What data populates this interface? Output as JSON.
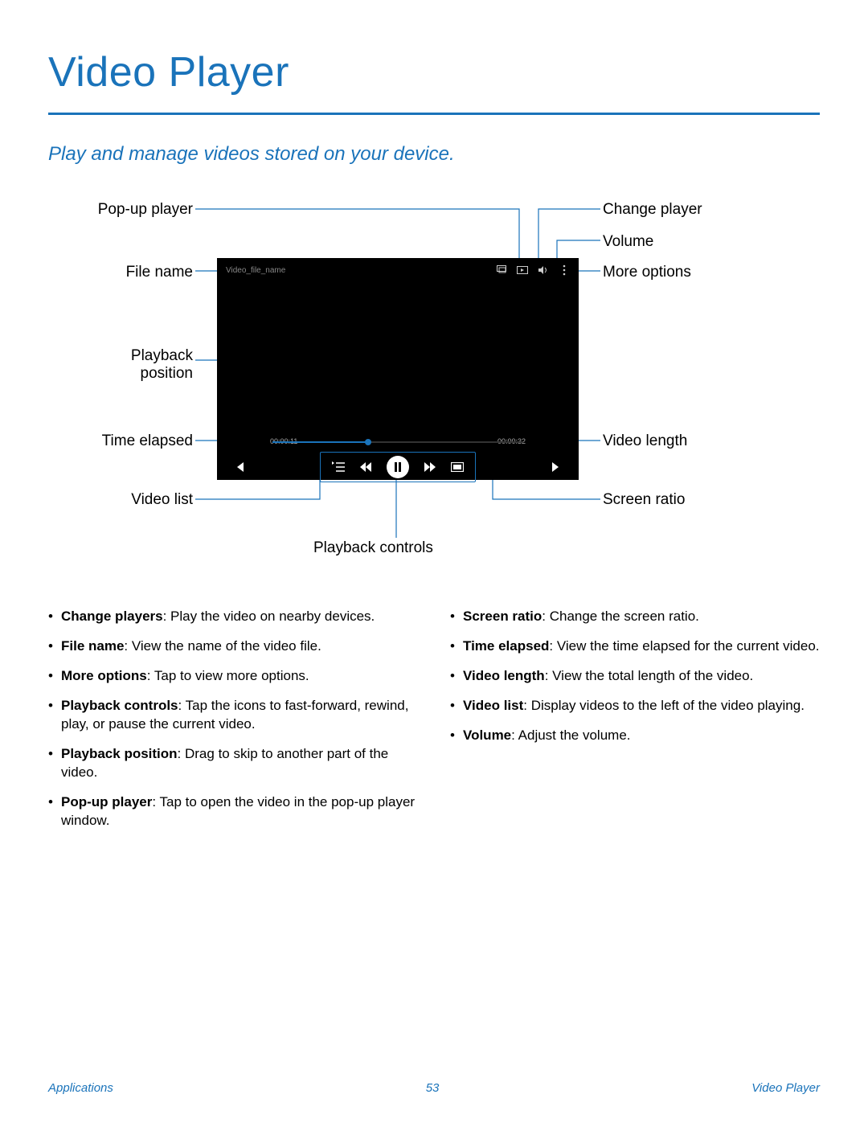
{
  "title": "Video Player",
  "subtitle": "Play and manage videos stored on your device.",
  "callouts": {
    "popup_player": "Pop-up player",
    "file_name": "File name",
    "playback_position": "Playback position",
    "time_elapsed": "Time elapsed",
    "video_list": "Video list",
    "playback_controls": "Playback controls",
    "change_player": "Change player",
    "volume": "Volume",
    "more_options": "More options",
    "video_length": "Video length",
    "screen_ratio": "Screen ratio"
  },
  "player": {
    "file_name": "Video_file_name",
    "time_elapsed": "00:00:11",
    "time_total": "00:00:32"
  },
  "desc_left": [
    {
      "bold": "Change players",
      "text": ": Play the video on nearby devices."
    },
    {
      "bold": "File name",
      "text": ": View the name of the video file."
    },
    {
      "bold": "More options",
      "text": ": Tap to view more options."
    },
    {
      "bold": "Playback controls",
      "text": ": Tap the icons to fast-forward, rewind, play, or pause the current video."
    },
    {
      "bold": "Playback position",
      "text": ": Drag to skip to another part of the video."
    },
    {
      "bold": "Pop-up player",
      "text": ": Tap to open the video in the pop-up player window."
    }
  ],
  "desc_right": [
    {
      "bold": "Screen ratio",
      "text": ": Change the screen ratio."
    },
    {
      "bold": "Time elapsed",
      "text": ": View the time elapsed for the current video."
    },
    {
      "bold": "Video length",
      "text": ": View the total length of the video."
    },
    {
      "bold": "Video list",
      "text": ": Display videos to the left of the video playing."
    },
    {
      "bold": "Volume",
      "text": ": Adjust the volume."
    }
  ],
  "footer": {
    "left": "Applications",
    "center": "53",
    "right": "Video Player"
  }
}
